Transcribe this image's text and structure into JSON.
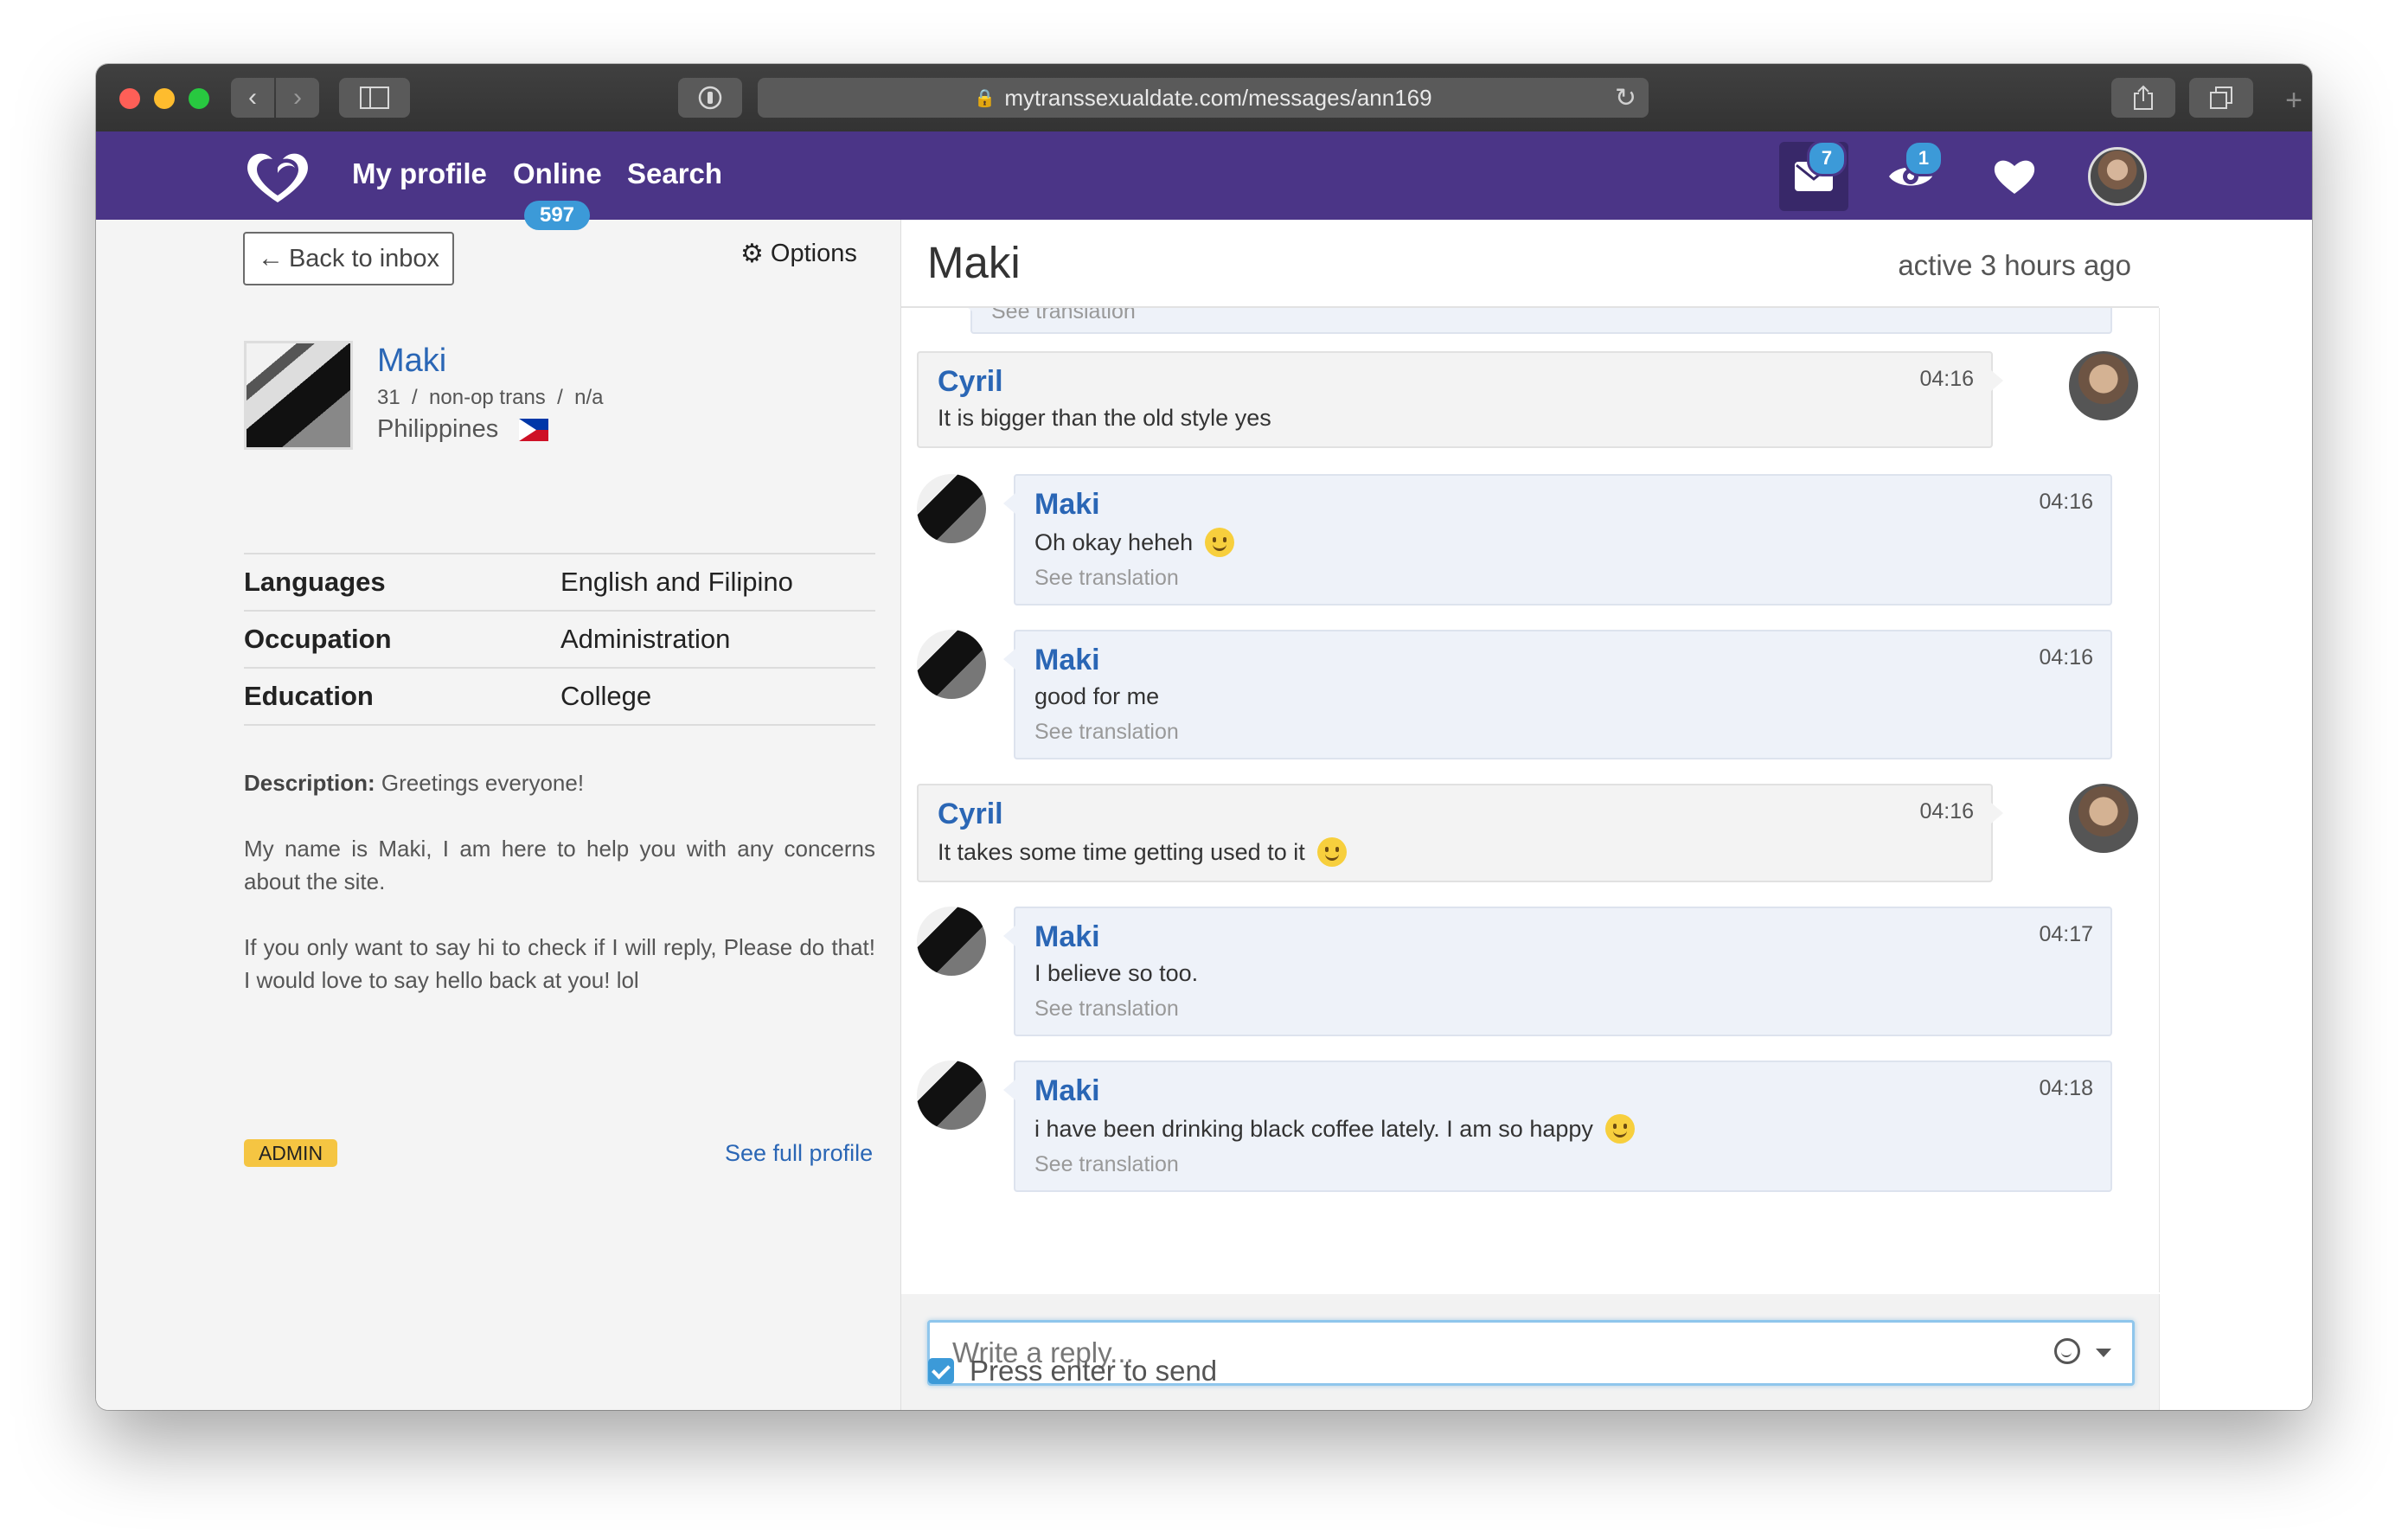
{
  "browser": {
    "url": "mytranssexualdate.com/messages/ann169"
  },
  "nav": {
    "my_profile": "My profile",
    "online": "Online",
    "search": "Search",
    "online_count": "597",
    "messages_badge": "7",
    "visitors_badge": "1",
    "brand_color": "#4b3587"
  },
  "left": {
    "back_label": "Back to inbox",
    "options_label": "Options",
    "profile": {
      "name": "Maki",
      "meta": "31  /  non-op trans  /  n/a",
      "country": "Philippines"
    },
    "details": [
      {
        "key": "Languages",
        "value": "English and Filipino"
      },
      {
        "key": "Occupation",
        "value": "Administration"
      },
      {
        "key": "Education",
        "value": "College"
      }
    ],
    "description_label": "Description:",
    "description_first": "Greetings everyone!",
    "description_p2": "My name is Maki, I am here to help you with any concerns about the site.",
    "description_p3": "If you only want to say hi to check if I will reply, Please do that! I would love to say hello back at you! lol",
    "admin_badge": "ADMIN",
    "full_profile": "See full profile"
  },
  "chat": {
    "title": "Maki",
    "active": "active 3 hours ago",
    "top_partial": "See translation",
    "translation_label": "See translation",
    "messages": [
      {
        "sender": "Cyril",
        "time": "04:16",
        "text": "It is bigger than the old style yes"
      },
      {
        "sender": "Maki",
        "time": "04:16",
        "text": "Oh okay heheh"
      },
      {
        "sender": "Maki",
        "time": "04:16",
        "text": "good for me"
      },
      {
        "sender": "Cyril",
        "time": "04:16",
        "text": "It takes some time getting used to it"
      },
      {
        "sender": "Maki",
        "time": "04:17",
        "text": "I believe so too."
      },
      {
        "sender": "Maki",
        "time": "04:18",
        "text": "i have been drinking black coffee lately. I am so happy"
      }
    ]
  },
  "reply": {
    "placeholder": "Write a reply...",
    "press_enter": "Press enter to send"
  }
}
